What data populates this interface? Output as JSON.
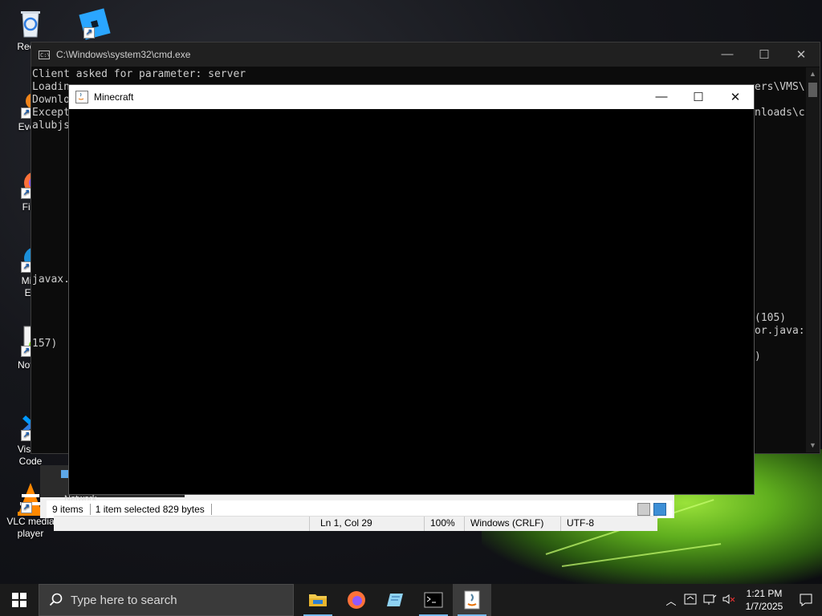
{
  "desktop": {
    "icons": [
      {
        "label": "Recycle Bin",
        "visible_label": "Recyc"
      },
      {
        "label": "Roblox",
        "visible_label": ""
      },
      {
        "label": "Everything",
        "visible_label": "Every"
      },
      {
        "label": "Firefox",
        "visible_label": "Fire"
      },
      {
        "label": "Microsoft Edge",
        "line1": "Micr",
        "line2": "Ed"
      },
      {
        "label": "Notepad++",
        "visible_label": "Notep"
      },
      {
        "label": "Visual Studio Code",
        "line1": "Visual",
        "line2": "Code"
      },
      {
        "label": "VLC media player",
        "line1": "VLC media",
        "line2": "player"
      }
    ]
  },
  "cmd": {
    "title": "C:\\Windows\\system32\\cmd.exe",
    "lines": [
      "Client asked for parameter: server",
      "Loadin",
      "Downlo",
      "Except",
      "alubjs"
    ],
    "right_fragments": {
      "line_loading_right": "ers\\VMS\\",
      "line_except_right": "nloads\\c",
      "line_105": "(105)",
      "line_javac": "or.java:",
      "line_paren": ")"
    },
    "javax": "javax.",
    "line_157": "157)"
  },
  "minecraft": {
    "title": "Minecraft"
  },
  "explorer_status": {
    "items": "9 items",
    "selected": "1 item selected  829 bytes",
    "nav_fragment": "Network"
  },
  "notepad_status": {
    "position": "Ln 1, Col 29",
    "zoom": "100%",
    "line_ending": "Windows (CRLF)",
    "encoding": "UTF-8"
  },
  "taskbar": {
    "search_placeholder": "Type here to search",
    "time": "1:21 PM",
    "date": "1/7/2025",
    "apps": [
      {
        "name": "File Explorer",
        "icon": "folder-icon"
      },
      {
        "name": "Firefox",
        "icon": "firefox-icon"
      },
      {
        "name": "Notepad",
        "icon": "notepad-icon"
      },
      {
        "name": "Command Prompt",
        "icon": "terminal-icon"
      },
      {
        "name": "Java",
        "icon": "java-icon",
        "active": true
      }
    ]
  },
  "colors": {
    "cmd_bg": "#0c0c0c",
    "cmd_text": "#cccccc",
    "taskbar_bg": "#1b1b1b",
    "accent": "#76b9ed"
  }
}
